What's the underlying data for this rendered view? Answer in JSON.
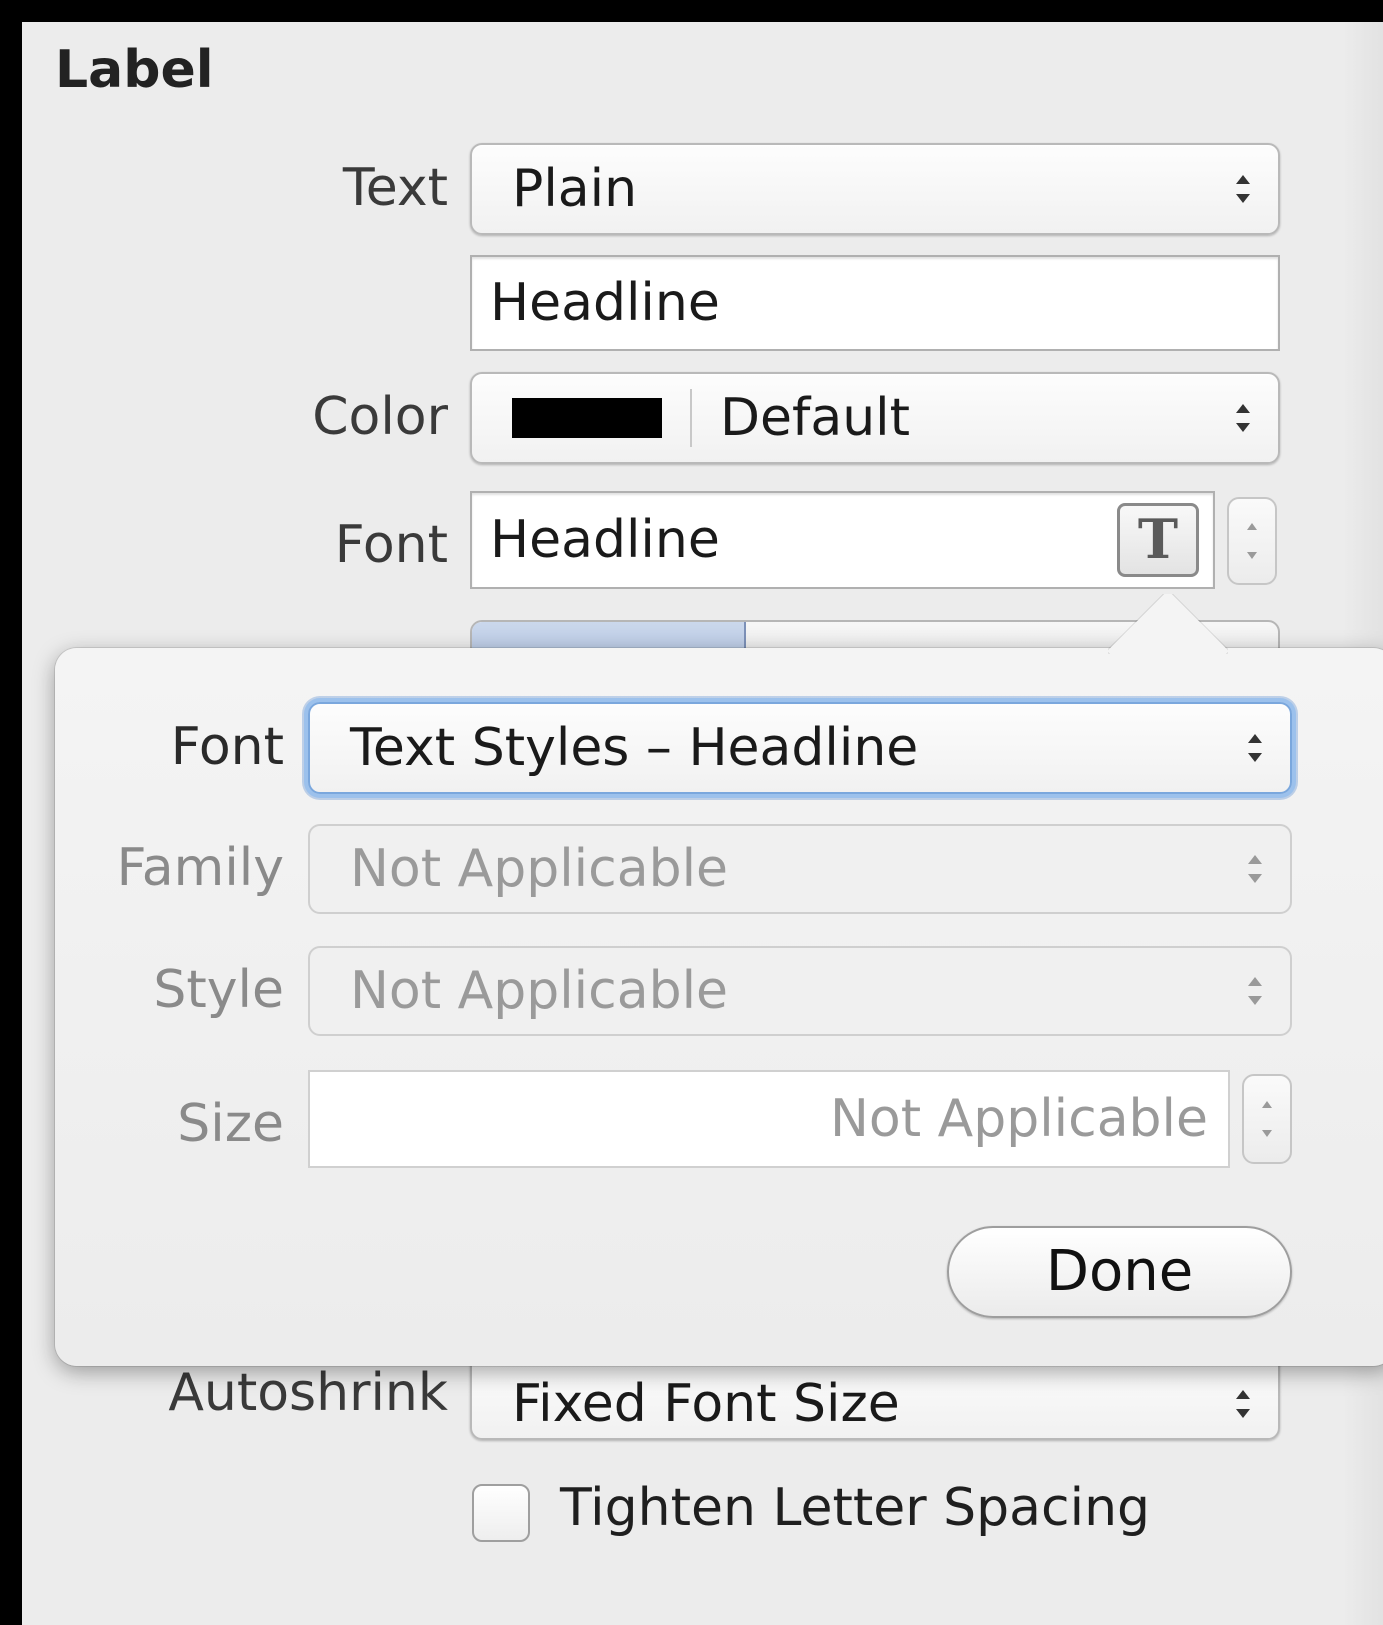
{
  "section": {
    "title": "Label"
  },
  "rows": {
    "text_label": "Text",
    "text_value": "Plain",
    "headline_field": "Headline",
    "color_label": "Color",
    "color_value": "Default",
    "color_swatch": "#000000",
    "font_label": "Font",
    "font_value": "Headline",
    "autoshrink_label": "Autoshrink",
    "autoshrink_value": "Fixed Font Size",
    "tighten_label": "Tighten Letter Spacing",
    "tighten_checked": false
  },
  "icons": {
    "font_picker": "text-T-icon",
    "stepper": "up-down-stepper-icon",
    "popup_arrows": "up-down-chevron-icon"
  },
  "popover": {
    "font_label": "Font",
    "font_value": "Text Styles – Headline",
    "family_label": "Family",
    "family_value": "Not Applicable",
    "style_label": "Style",
    "style_value": "Not Applicable",
    "size_label": "Size",
    "size_value": "Not Applicable",
    "done_label": "Done"
  },
  "colors": {
    "focus_ring": "#7aa7dd",
    "panel_bg": "#ececec"
  }
}
